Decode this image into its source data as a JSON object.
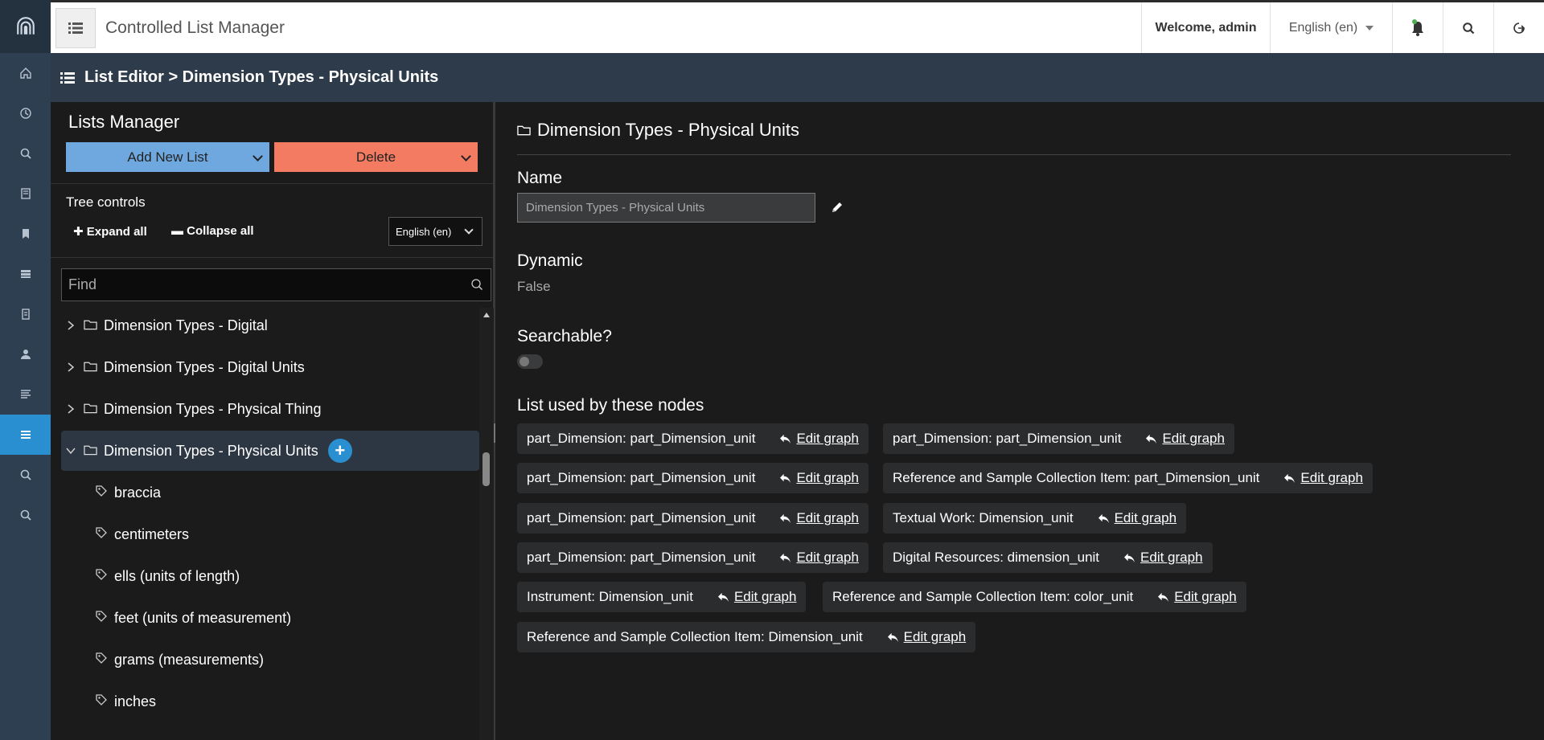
{
  "app": {
    "title": "Controlled List Manager",
    "welcome": "Welcome, admin",
    "language": "English (en)"
  },
  "rail": {
    "icons": [
      "logo-icon",
      "home-icon",
      "clock-icon",
      "search-icon",
      "book-icon",
      "bookmark-icon",
      "database-icon",
      "document-icon",
      "user-icon",
      "text-icon",
      "list-icon",
      "search-icon",
      "search-icon"
    ]
  },
  "breadcrumb": {
    "text": "List Editor > Dimension Types - Physical Units"
  },
  "lists_manager": {
    "title": "Lists Manager",
    "add_label": "Add New List",
    "delete_label": "Delete",
    "tree_controls_label": "Tree controls",
    "expand_label": "Expand all",
    "collapse_label": "Collapse all",
    "language": "English (en)",
    "find_placeholder": "Find",
    "tree": [
      {
        "label": "Dimension Types - Digital"
      },
      {
        "label": "Dimension Types - Digital Units"
      },
      {
        "label": "Dimension Types - Physical Thing"
      },
      {
        "label": "Dimension Types - Physical Units"
      }
    ],
    "leaves": [
      "braccia",
      "centimeters",
      "ells (units of length)",
      "feet (units of measurement)",
      "grams (measurements)",
      "inches"
    ]
  },
  "detail": {
    "title": "Dimension Types - Physical Units",
    "name_label": "Name",
    "name_value": "Dimension Types - Physical Units",
    "dynamic_label": "Dynamic",
    "dynamic_value": "False",
    "searchable_label": "Searchable?",
    "searchable_on": false,
    "nodes_label": "List used by these nodes",
    "edit_label": "Edit graph",
    "nodes": [
      "part_Dimension: part_Dimension_unit",
      "part_Dimension: part_Dimension_unit",
      "part_Dimension: part_Dimension_unit",
      "Reference and Sample Collection Item: part_Dimension_unit",
      "part_Dimension: part_Dimension_unit",
      "Textual Work: Dimension_unit",
      "part_Dimension: part_Dimension_unit",
      "Digital Resources: dimension_unit",
      "Instrument: Dimension_unit",
      "Reference and Sample Collection Item: color_unit",
      "Reference and Sample Collection Item: Dimension_unit"
    ]
  },
  "colors": {
    "accent": "#2a8fd0",
    "add": "#6fa8de",
    "delete": "#f27b62"
  }
}
